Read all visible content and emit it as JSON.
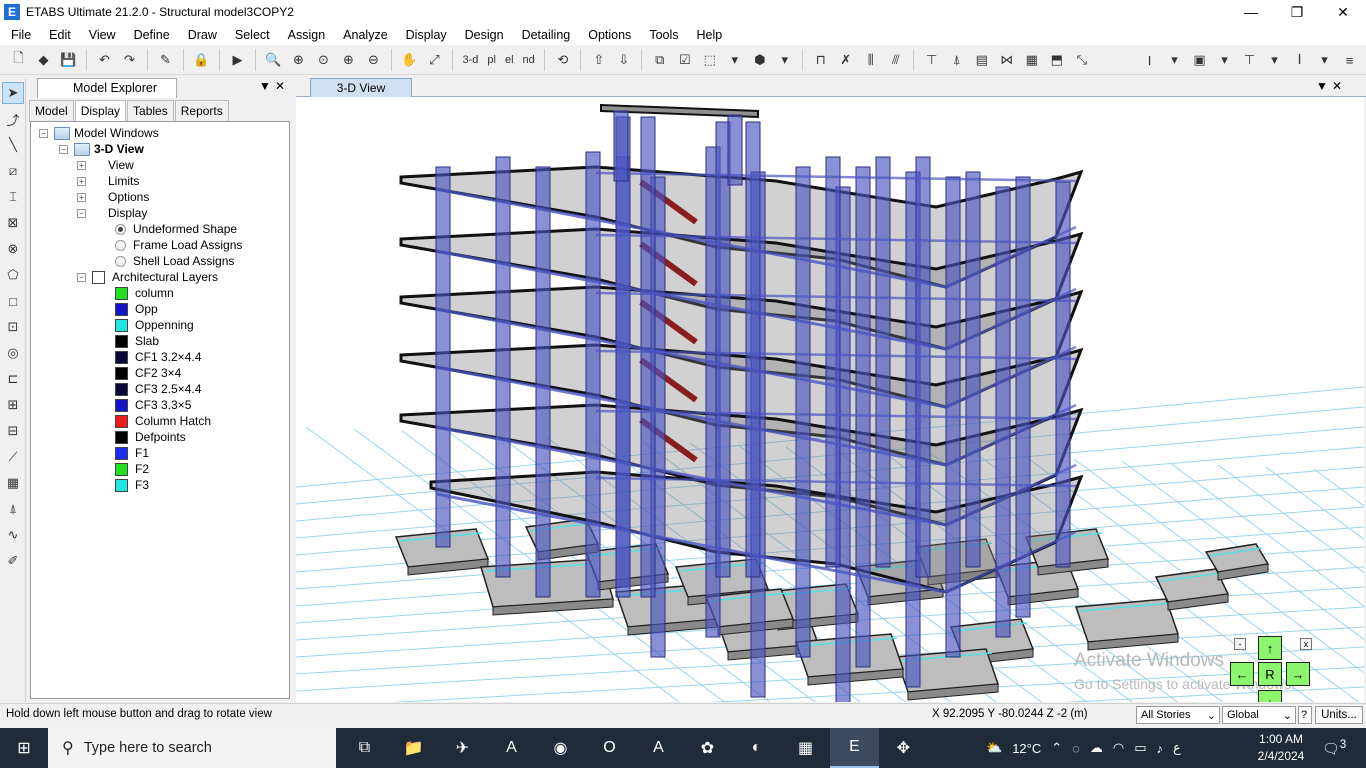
{
  "window": {
    "title": "ETABS Ultimate 21.2.0 - Structural model3COPY2",
    "app_icon": "E",
    "minimize": "—",
    "maximize": "❐",
    "close": "✕"
  },
  "menu": [
    "File",
    "Edit",
    "View",
    "Define",
    "Draw",
    "Select",
    "Assign",
    "Analyze",
    "Display",
    "Design",
    "Detailing",
    "Options",
    "Tools",
    "Help"
  ],
  "toolbar": {
    "view_3d": "3-d",
    "plan": "pl",
    "elevation": "el",
    "nd": "nd"
  },
  "explorer": {
    "title": "Model Explorer",
    "pin": "▼",
    "close": "✕",
    "tabs": [
      "Model",
      "Display",
      "Tables",
      "Reports"
    ],
    "active_tab": "Display",
    "tree": {
      "root": "Model Windows",
      "view": "3-D View",
      "items": [
        "View",
        "Limits",
        "Options",
        "Display"
      ],
      "display_options": [
        "Undeformed Shape",
        "Frame Load Assigns",
        "Shell Load Assigns"
      ],
      "selected_option": "Undeformed Shape",
      "arch_layers": "Architectural Layers",
      "layers": [
        {
          "name": "column",
          "color": "#22e022"
        },
        {
          "name": "Opp",
          "color": "#1414c8"
        },
        {
          "name": "Oppenning",
          "color": "#22e6e6"
        },
        {
          "name": "Slab",
          "color": "#000000"
        },
        {
          "name": "CF1 3.2×4.4",
          "color": "#0a0a3a"
        },
        {
          "name": "CF2 3×4",
          "color": "#000000"
        },
        {
          "name": "CF3 2.5×4.4",
          "color": "#0a0a3a"
        },
        {
          "name": "CF3 3.3×5",
          "color": "#1414c8"
        },
        {
          "name": "Column Hatch",
          "color": "#ee1a1a"
        },
        {
          "name": "Defpoints",
          "color": "#000000"
        },
        {
          "name": "F1",
          "color": "#1a2ef0"
        },
        {
          "name": "F2",
          "color": "#22e022"
        },
        {
          "name": "F3",
          "color": "#22e6e6"
        }
      ]
    }
  },
  "view": {
    "tab": "3-D View",
    "pin": "▼",
    "close": "✕"
  },
  "watermark": {
    "line1": "Activate Windows",
    "line2": "Go to Settings to activate Windows."
  },
  "navpad": {
    "up": "↑",
    "down": "↓",
    "left": "←",
    "right": "→",
    "center": "R",
    "minus": "-",
    "x": "x"
  },
  "status": {
    "message": "Hold down left mouse button and drag to rotate view",
    "coords": "X 92.2095  Y -80.0244  Z -2 (m)",
    "stories": "All Stories",
    "coord_system": "Global",
    "help": "?",
    "units": "Units..."
  },
  "taskbar": {
    "search_placeholder": "Type here to search",
    "temperature": "12°C",
    "time": "1:00 AM",
    "date": "2/4/2024",
    "lang": "ع",
    "notifications": "3"
  },
  "colors": {
    "frame": "#4a55c0",
    "slab": "#7c7c7c",
    "grid": "#9bd3ee",
    "stair": "#8a1e1e",
    "footing": "#55e0e0"
  }
}
